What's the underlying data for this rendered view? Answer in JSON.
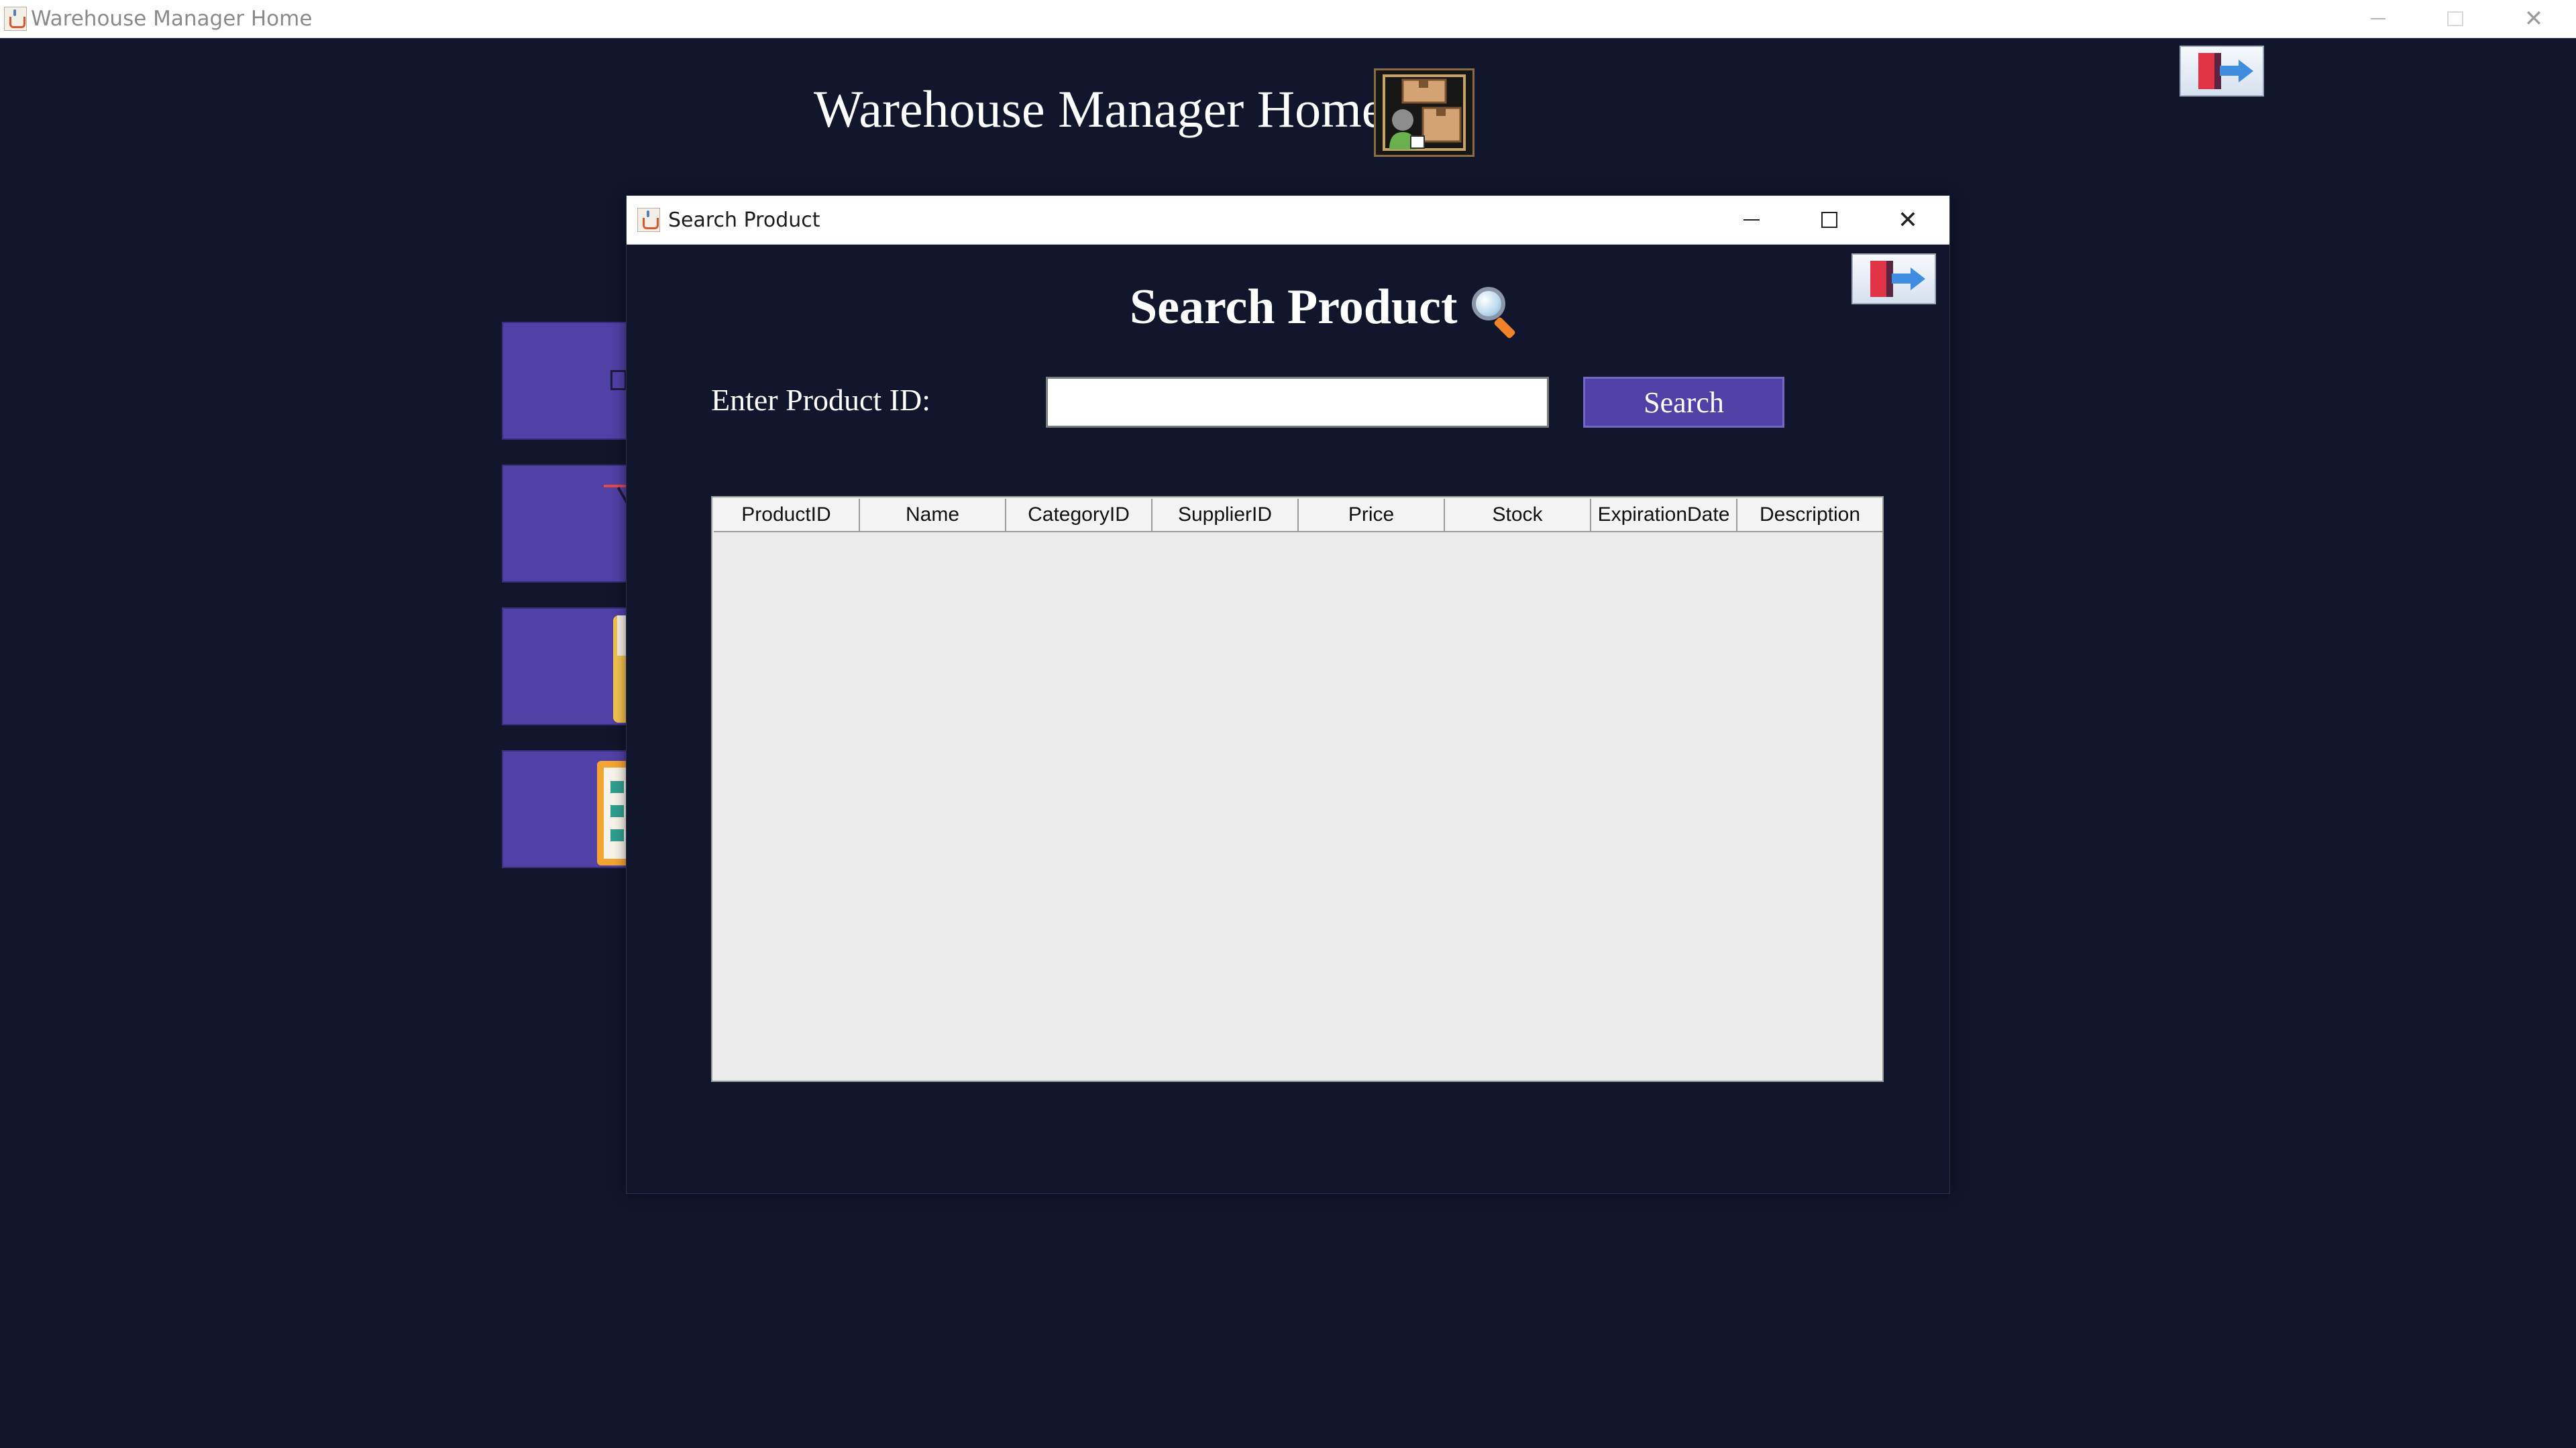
{
  "main_window": {
    "title": "Warehouse Manager Home",
    "controls": {
      "minimize": "minimize",
      "maximize": "maximize",
      "close": "close"
    }
  },
  "home": {
    "heading": "Warehouse Manager Home",
    "heading_icon": "warehouse-manager-icon",
    "exit_icon": "exit-door-icon"
  },
  "side_menu": {
    "items": [
      {
        "icon": "product-icon"
      },
      {
        "icon": "cart-icon"
      },
      {
        "icon": "bottle-icon"
      },
      {
        "icon": "checklist-icon"
      }
    ],
    "color": "#5140a5"
  },
  "dialog": {
    "title": "Search Product",
    "heading": "Search Product",
    "heading_icon": "magnifier-icon",
    "exit_icon": "exit-door-icon",
    "form": {
      "label": "Enter Product ID:",
      "input_value": "",
      "search_button": "Search"
    },
    "table": {
      "columns": [
        "ProductID",
        "Name",
        "CategoryID",
        "SupplierID",
        "Price",
        "Stock",
        "ExpirationDate",
        "Description"
      ],
      "rows": []
    }
  },
  "colors": {
    "background": "#11162d",
    "accent": "#5140a5",
    "table_bg": "#ececec"
  }
}
